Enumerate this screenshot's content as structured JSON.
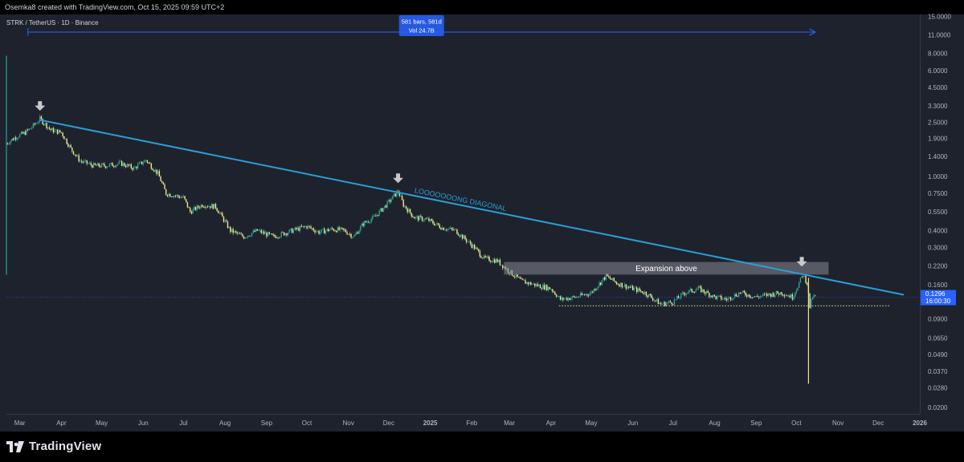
{
  "header": {
    "caption": "Osemka8 created with TradingView.com, Oct 15, 2025 09:59 UTC+2"
  },
  "symbol": {
    "title": "STRK / TetherUS · 1D · Binance"
  },
  "branding": {
    "name": "TradingView",
    "logo_icon": "tradingview-logo-icon"
  },
  "colors": {
    "background": "#1e222d",
    "candle_up": "#26a69a",
    "candle_down": "#f0e68c",
    "trendline": "#2a9fd6",
    "measure": "#2962ff",
    "support": "#f0e68c",
    "price_label": "#2962ff"
  },
  "chart_data": {
    "type": "candlestick",
    "pair": "STRK / TetherUS",
    "interval": "1D",
    "exchange": "Binance",
    "y_scale": "log",
    "ylim": [
      0.018,
      15.5
    ],
    "y_ticks": [
      "15.0000",
      "11.0000",
      "8.0000",
      "6.0000",
      "4.5000",
      "3.3000",
      "2.5000",
      "1.9000",
      "1.4000",
      "1.0000",
      "0.7500",
      "0.5500",
      "0.4000",
      "0.3000",
      "0.2200",
      "0.1600",
      "0.1200",
      "0.0900",
      "0.0650",
      "0.0490",
      "0.0370",
      "0.0280",
      "0.0200"
    ],
    "x_ticks": [
      "Mar",
      "Apr",
      "May",
      "Jun",
      "Jul",
      "Aug",
      "Sep",
      "Oct",
      "Nov",
      "Dec",
      "2025",
      "Feb",
      "Mar",
      "Apr",
      "May",
      "Jun",
      "Jul",
      "Aug",
      "Sep",
      "Oct",
      "Nov",
      "Dec",
      "2026"
    ],
    "xlim": [
      "2024-02-20",
      "2026-01-01"
    ],
    "price_path": [
      [
        "2024-02-20",
        1.75
      ],
      [
        "2024-02-27",
        1.95
      ],
      [
        "2024-03-05",
        2.1
      ],
      [
        "2024-03-10",
        2.3
      ],
      [
        "2024-03-16",
        2.65
      ],
      [
        "2024-03-24",
        2.2
      ],
      [
        "2024-04-01",
        2.1
      ],
      [
        "2024-04-08",
        1.6
      ],
      [
        "2024-04-15",
        1.3
      ],
      [
        "2024-04-25",
        1.2
      ],
      [
        "2024-05-05",
        1.2
      ],
      [
        "2024-05-15",
        1.25
      ],
      [
        "2024-05-25",
        1.15
      ],
      [
        "2024-06-03",
        1.32
      ],
      [
        "2024-06-12",
        1.05
      ],
      [
        "2024-06-18",
        0.75
      ],
      [
        "2024-07-01",
        0.7
      ],
      [
        "2024-07-06",
        0.55
      ],
      [
        "2024-07-15",
        0.62
      ],
      [
        "2024-07-25",
        0.6
      ],
      [
        "2024-08-05",
        0.4
      ],
      [
        "2024-08-15",
        0.36
      ],
      [
        "2024-08-25",
        0.4
      ],
      [
        "2024-09-06",
        0.36
      ],
      [
        "2024-09-20",
        0.4
      ],
      [
        "2024-10-01",
        0.43
      ],
      [
        "2024-10-10",
        0.39
      ],
      [
        "2024-10-20",
        0.41
      ],
      [
        "2024-10-29",
        0.4
      ],
      [
        "2024-11-05",
        0.36
      ],
      [
        "2024-11-12",
        0.45
      ],
      [
        "2024-11-20",
        0.5
      ],
      [
        "2024-11-28",
        0.6
      ],
      [
        "2024-12-05",
        0.72
      ],
      [
        "2024-12-08",
        0.78
      ],
      [
        "2024-12-12",
        0.62
      ],
      [
        "2024-12-20",
        0.5
      ],
      [
        "2024-12-30",
        0.48
      ],
      [
        "2025-01-10",
        0.42
      ],
      [
        "2025-01-20",
        0.4
      ],
      [
        "2025-02-03",
        0.3
      ],
      [
        "2025-02-10",
        0.25
      ],
      [
        "2025-02-20",
        0.24
      ],
      [
        "2025-03-01",
        0.2
      ],
      [
        "2025-03-10",
        0.17
      ],
      [
        "2025-03-20",
        0.16
      ],
      [
        "2025-04-01",
        0.15
      ],
      [
        "2025-04-08",
        0.125
      ],
      [
        "2025-04-20",
        0.13
      ],
      [
        "2025-05-01",
        0.14
      ],
      [
        "2025-05-12",
        0.185
      ],
      [
        "2025-05-20",
        0.165
      ],
      [
        "2025-06-01",
        0.15
      ],
      [
        "2025-06-10",
        0.14
      ],
      [
        "2025-06-22",
        0.115
      ],
      [
        "2025-07-01",
        0.12
      ],
      [
        "2025-07-10",
        0.14
      ],
      [
        "2025-07-20",
        0.15
      ],
      [
        "2025-08-01",
        0.13
      ],
      [
        "2025-08-10",
        0.125
      ],
      [
        "2025-08-20",
        0.14
      ],
      [
        "2025-09-01",
        0.13
      ],
      [
        "2025-09-10",
        0.135
      ],
      [
        "2025-09-20",
        0.14
      ],
      [
        "2025-09-28",
        0.13
      ],
      [
        "2025-10-03",
        0.165
      ],
      [
        "2025-10-06",
        0.19
      ],
      [
        "2025-10-09",
        0.165
      ],
      [
        "2025-10-11",
        0.11
      ],
      [
        "2025-10-13",
        0.13
      ],
      [
        "2025-10-15",
        0.1296
      ]
    ],
    "wicks": [
      {
        "date": "2024-02-20",
        "high": 7.7,
        "low": 0.19
      },
      {
        "date": "2025-10-10",
        "high": 0.18,
        "low": 0.03
      }
    ],
    "last_price": {
      "value": "0.1296",
      "countdown": "16:00:30"
    },
    "annotations": {
      "diagonal_label": "LOOOOOOONG DIAGONAL",
      "diagonal": {
        "from": [
          "2024-03-16",
          2.6
        ],
        "to": [
          "2025-12-20",
          0.135
        ]
      },
      "zone_label": "Expansion above",
      "zone": {
        "from": "2025-02-25",
        "to": "2025-10-25",
        "top": 0.235,
        "bottom": 0.19
      },
      "support": {
        "from": "2025-04-07",
        "to": "2025-12-10",
        "value": 0.112
      },
      "arrows": [
        [
          "2024-03-16",
          2.65
        ],
        [
          "2024-12-08",
          0.78
        ],
        [
          "2025-10-05",
          0.19
        ]
      ],
      "measure": {
        "from": "2024-03-07",
        "to": "2025-10-15",
        "level": 11.5,
        "bars_label": "581 bars, 581d",
        "vol_label": "Vol 24.7B"
      }
    }
  }
}
